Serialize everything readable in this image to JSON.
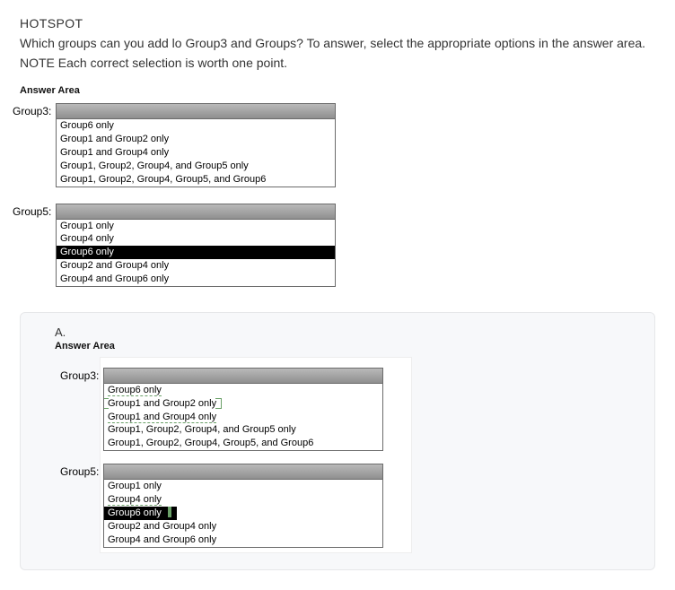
{
  "title": "HOTSPOT",
  "question": "Which groups can you add lo Group3 and Groups? To answer, select the appropriate options in the answer area. NOTE Each correct selection is worth one point.",
  "answer_area_label": "Answer Area",
  "q": {
    "group3": {
      "label": "Group3:",
      "options": [
        "Group6 only",
        "Group1 and Group2 only",
        "Group1 and Group4 only",
        "Group1, Group2, Group4, and Group5 only",
        "Group1, Group2, Group4, Group5, and Group6"
      ],
      "selected_index": null
    },
    "group5": {
      "label": "Group5:",
      "options": [
        "Group1 only",
        "Group4 only",
        "Group6 only",
        "Group2 and Group4 only",
        "Group4 and Group6 only"
      ],
      "selected_index": 2
    }
  },
  "ans": {
    "letter": "A.",
    "area_label": "Answer Area",
    "group3": {
      "label": "Group3:",
      "options": [
        "Group6 only",
        "Group1 and Group2 only",
        "Group1 and Group4 only",
        "Group1, Group2, Group4, and Group5 only",
        "Group1, Group2, Group4, Group5, and Group6"
      ],
      "correct_index": 1
    },
    "group5": {
      "label": "Group5:",
      "options": [
        "Group1 only",
        "Group4 only",
        "Group6 only",
        "Group2 and Group4 only",
        "Group4 and Group6 only"
      ],
      "correct_index": 2
    }
  }
}
